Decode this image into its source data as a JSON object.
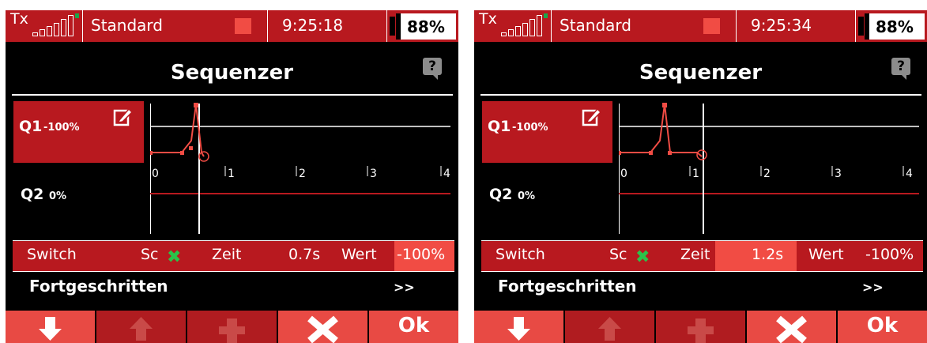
{
  "colors": {
    "accent_red": "#b8191f",
    "highlight_red": "#f14c44",
    "check_green": "#2bc24a"
  },
  "screens": [
    {
      "status": {
        "tx": "Tx",
        "model": "Standard",
        "time": "9:25:18",
        "battery": "88%"
      },
      "title": "Sequenzer",
      "help_icon": "?",
      "q1": {
        "name": "Q1",
        "value": "-100%"
      },
      "q2": {
        "name": "Q2",
        "value": "0%"
      },
      "graph": {
        "ticks": [
          "0",
          "1",
          "2",
          "3",
          "4"
        ],
        "cursor_time": 0.7
      },
      "params": {
        "switch_label": "Switch",
        "switch_value": "Sc",
        "zeit_label": "Zeit",
        "zeit_value": "0.7s",
        "wert_label": "Wert",
        "wert_value": "-100%",
        "selected": "wert"
      },
      "advanced": {
        "label": "Fortgeschritten",
        "arrow": ">>"
      },
      "buttons": {
        "ok": "Ok"
      }
    },
    {
      "status": {
        "tx": "Tx",
        "model": "Standard",
        "time": "9:25:34",
        "battery": "88%"
      },
      "title": "Sequenzer",
      "help_icon": "?",
      "q1": {
        "name": "Q1",
        "value": "-100%"
      },
      "q2": {
        "name": "Q2",
        "value": "0%"
      },
      "graph": {
        "ticks": [
          "0",
          "1",
          "2",
          "3",
          "4"
        ],
        "cursor_time": 1.2
      },
      "params": {
        "switch_label": "Switch",
        "switch_value": "Sc",
        "zeit_label": "Zeit",
        "zeit_value": "1.2s",
        "wert_label": "Wert",
        "wert_value": "-100%",
        "selected": "zeit"
      },
      "advanced": {
        "label": "Fortgeschritten",
        "arrow": ">>"
      },
      "buttons": {
        "ok": "Ok"
      }
    }
  ]
}
